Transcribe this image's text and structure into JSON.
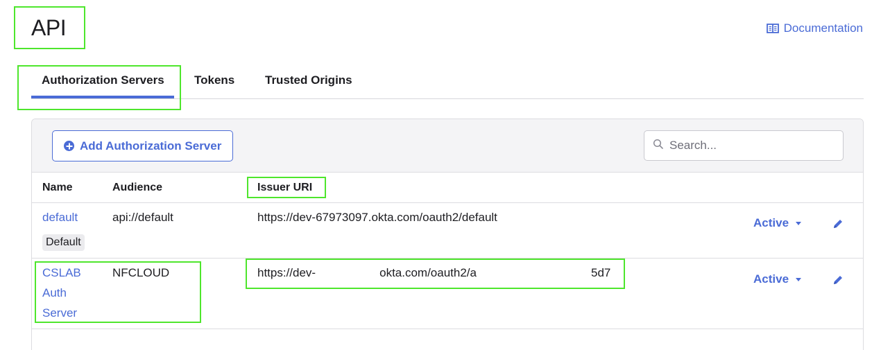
{
  "page": {
    "title": "API"
  },
  "header": {
    "documentation_label": "Documentation"
  },
  "tabs": [
    {
      "label": "Authorization Servers",
      "active": true
    },
    {
      "label": "Tokens",
      "active": false
    },
    {
      "label": "Trusted Origins",
      "active": false
    }
  ],
  "toolbar": {
    "add_button_label": "Add Authorization Server",
    "search_placeholder": "Search..."
  },
  "table": {
    "columns": [
      "Name",
      "Audience",
      "Issuer URI"
    ],
    "rows": [
      {
        "name": "default",
        "badge": "Default",
        "audience": "api://default",
        "issuer_uri": "https://dev-67973097.okta.com/oauth2/default",
        "status": "Active"
      },
      {
        "name_lines": [
          "CSLAB",
          "Auth",
          "Server"
        ],
        "audience": "NFCLOUD",
        "issuer_parts": [
          "https://dev-",
          "okta.com/oauth2/a",
          "5d7"
        ],
        "status": "Active"
      }
    ]
  },
  "colors": {
    "accent": "#4a6bd6",
    "highlight_outline": "#4ee62c"
  }
}
